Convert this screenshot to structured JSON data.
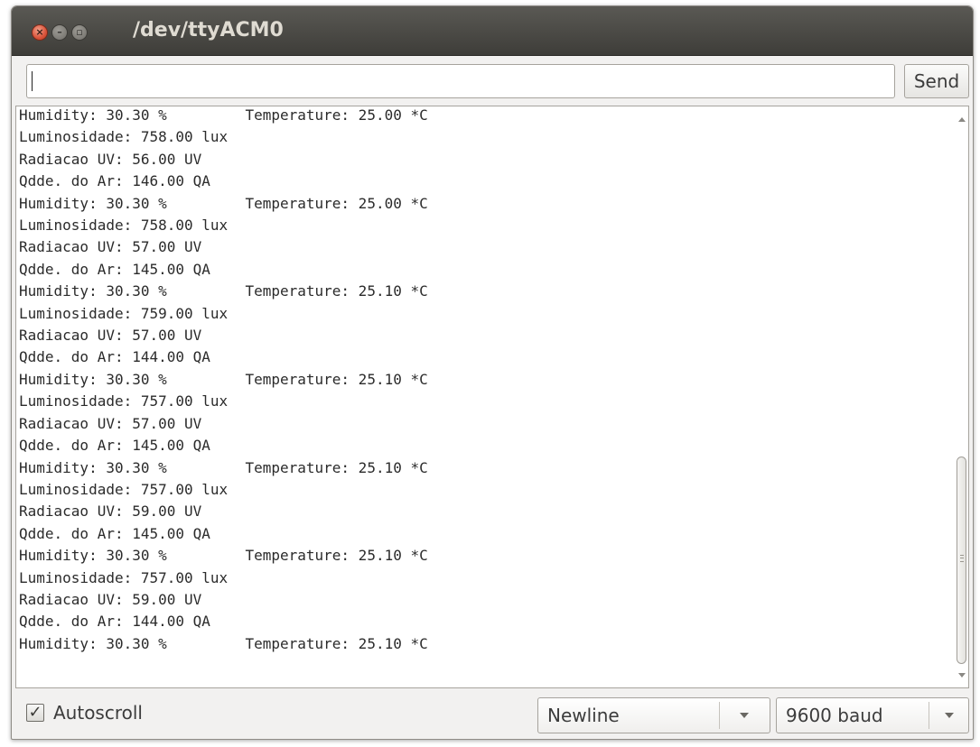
{
  "window": {
    "title": "/dev/ttyACM0",
    "close_glyph": "×",
    "minimize_glyph": "–",
    "maximize_glyph": "▫"
  },
  "send_bar": {
    "input_value": "",
    "send_label": "Send"
  },
  "serial_output": [
    "Humidity: 30.30 %\tTemperature: 25.00 *C",
    "Luminosidade: 758.00 lux",
    "Radiacao UV: 56.00 UV",
    "Qdde. do Ar: 146.00 QA",
    "Humidity: 30.30 %\tTemperature: 25.00 *C",
    "Luminosidade: 758.00 lux",
    "Radiacao UV: 57.00 UV",
    "Qdde. do Ar: 145.00 QA",
    "Humidity: 30.30 %\tTemperature: 25.10 *C",
    "Luminosidade: 759.00 lux",
    "Radiacao UV: 57.00 UV",
    "Qdde. do Ar: 144.00 QA",
    "Humidity: 30.30 %\tTemperature: 25.10 *C",
    "Luminosidade: 757.00 lux",
    "Radiacao UV: 57.00 UV",
    "Qdde. do Ar: 145.00 QA",
    "Humidity: 30.30 %\tTemperature: 25.10 *C",
    "Luminosidade: 757.00 lux",
    "Radiacao UV: 59.00 UV",
    "Qdde. do Ar: 145.00 QA",
    "Humidity: 30.30 %\tTemperature: 25.10 *C",
    "Luminosidade: 757.00 lux",
    "Radiacao UV: 59.00 UV",
    "Qdde. do Ar: 144.00 QA",
    "Humidity: 30.30 %\tTemperature: 25.10 *C"
  ],
  "footer": {
    "autoscroll_checked": true,
    "check_glyph": "✓",
    "autoscroll_label": "Autoscroll",
    "line_ending": "Newline",
    "baud_rate": "9600 baud"
  },
  "icons": {
    "close": "close-icon",
    "minimize": "minimize-icon",
    "maximize": "maximize-icon",
    "scroll_up": "arrow-up-icon",
    "scroll_down": "arrow-down-icon",
    "dropdown": "chevron-down-icon",
    "checkbox": "checkmark-icon"
  },
  "colors": {
    "titlebar": "#4a4945",
    "title_text": "#dfdbd2",
    "close_button": "#d9533a",
    "window_bg": "#f2f1f0",
    "output_bg": "#ffffff"
  }
}
